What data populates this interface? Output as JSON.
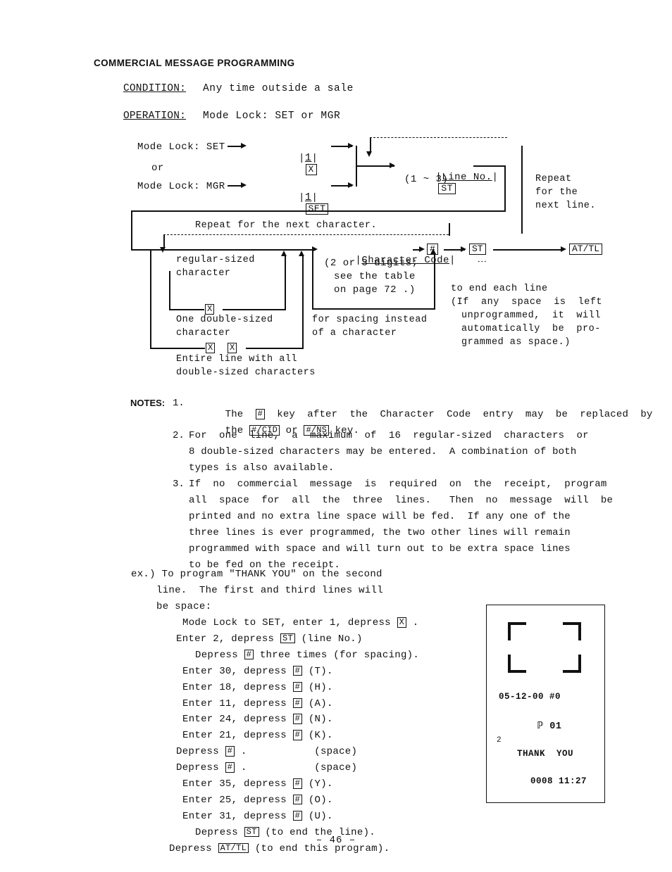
{
  "page_title": "COMMERCIAL MESSAGE PROGRAMMING",
  "header": {
    "condition_label": "CONDITION:",
    "condition_value": "Any time outside a sale",
    "operation_label": "OPERATION:",
    "operation_value": "Mode Lock: SET or MGR"
  },
  "flow": {
    "mode_set": "Mode Lock: SET",
    "or": "or",
    "mode_mgr": "Mode Lock: MGR",
    "digit_1": "1",
    "key_x": "X",
    "key_set": "SET",
    "line_no": "Line No.",
    "line_no_range": "(1 ~ 3)",
    "key_st": "ST",
    "repeat_line": [
      "Repeat",
      "for the",
      "next line."
    ],
    "repeat_char": "Repeat for the next character.",
    "char_code": "Character Code",
    "char_code_note": [
      "(2 or 3 digits;",
      "see the table",
      "on page 72 .)"
    ],
    "key_hash": "#",
    "key_st2": "ST",
    "key_attl": "AT/TL",
    "regular_sized": [
      "regular-sized",
      "character"
    ],
    "one_double": [
      "One double-sized",
      "character"
    ],
    "entire_line": [
      "Entire line with all",
      "double-sized characters"
    ],
    "for_spacing": [
      "for spacing instead",
      "of a character"
    ],
    "to_end_each_line": "to end each line",
    "auto_space_note": [
      "(If  any  space  is  left",
      "unprogrammed,  it  will",
      "automatically  be  pro-",
      "grammed as space.)"
    ],
    "vertical_dots": "⋮"
  },
  "notes": {
    "label": "NOTES:",
    "items": [
      {
        "num": "1.",
        "lines": [
          "The    key  after  the  Character  Code  entry  may  be  replaced  by",
          "the   or   key."
        ],
        "keys": [
          "#",
          "#/CID",
          "#/NS"
        ]
      },
      {
        "num": "2.",
        "lines": [
          "For  one  line,  a  maximum  of  16  regular-sized  characters  or",
          "8 double-sized characters may be entered.  A combination of both",
          "types is also available."
        ]
      },
      {
        "num": "3.",
        "lines": [
          "If  no  commercial  message  is  required  on  the  receipt,  program",
          "all  space  for  all  the  three  lines.   Then  no  message  will  be",
          "printed and no extra line space will be fed.  If any one of the",
          "three lines is ever programmed, the two other lines will remain",
          "programmed with space and will turn out to be extra space lines",
          "to be fed on the receipt."
        ]
      }
    ]
  },
  "example": {
    "intro": [
      "ex.) To program \"THANK YOU\" on the second",
      "line.  The first and third lines will",
      "be space:"
    ],
    "steps": [
      {
        "pre": "Mode Lock to SET, enter 1, depress ",
        "key": "X",
        "post": " ."
      },
      {
        "pre": "Enter 2, depress ",
        "key": "ST",
        "post": " (line No.)"
      },
      {
        "pre": "Depress ",
        "key": "#",
        "post": " three times (for spacing)."
      },
      {
        "pre": "Enter 30, depress ",
        "key": "#",
        "post": " (T)."
      },
      {
        "pre": "Enter 18, depress ",
        "key": "#",
        "post": " (H)."
      },
      {
        "pre": "Enter 11, depress ",
        "key": "#",
        "post": " (A)."
      },
      {
        "pre": "Enter 24, depress ",
        "key": "#",
        "post": " (N)."
      },
      {
        "pre": "Enter 21, depress ",
        "key": "#",
        "post": " (K)."
      },
      {
        "pre": "Depress ",
        "key": "#",
        "post": " .           (space)"
      },
      {
        "pre": "Depress ",
        "key": "#",
        "post": " .           (space)"
      },
      {
        "pre": "Enter 35, depress ",
        "key": "#",
        "post": " (Y)."
      },
      {
        "pre": "Enter 25, depress ",
        "key": "#",
        "post": " (O)."
      },
      {
        "pre": "Enter 31, depress ",
        "key": "#",
        "post": " (U)."
      },
      {
        "pre": "Depress ",
        "key": "ST",
        "post": " (to end the line)."
      },
      {
        "pre": "Depress ",
        "key": "AT/TL",
        "post": " (to end this program)."
      }
    ]
  },
  "receipt": {
    "date_line": "05-12-00 #0",
    "p_line": "ℙ 01",
    "line_marker": "2",
    "message": "THANK  YOU",
    "footer": "0008 11:27"
  },
  "page_number": "– 46 –"
}
